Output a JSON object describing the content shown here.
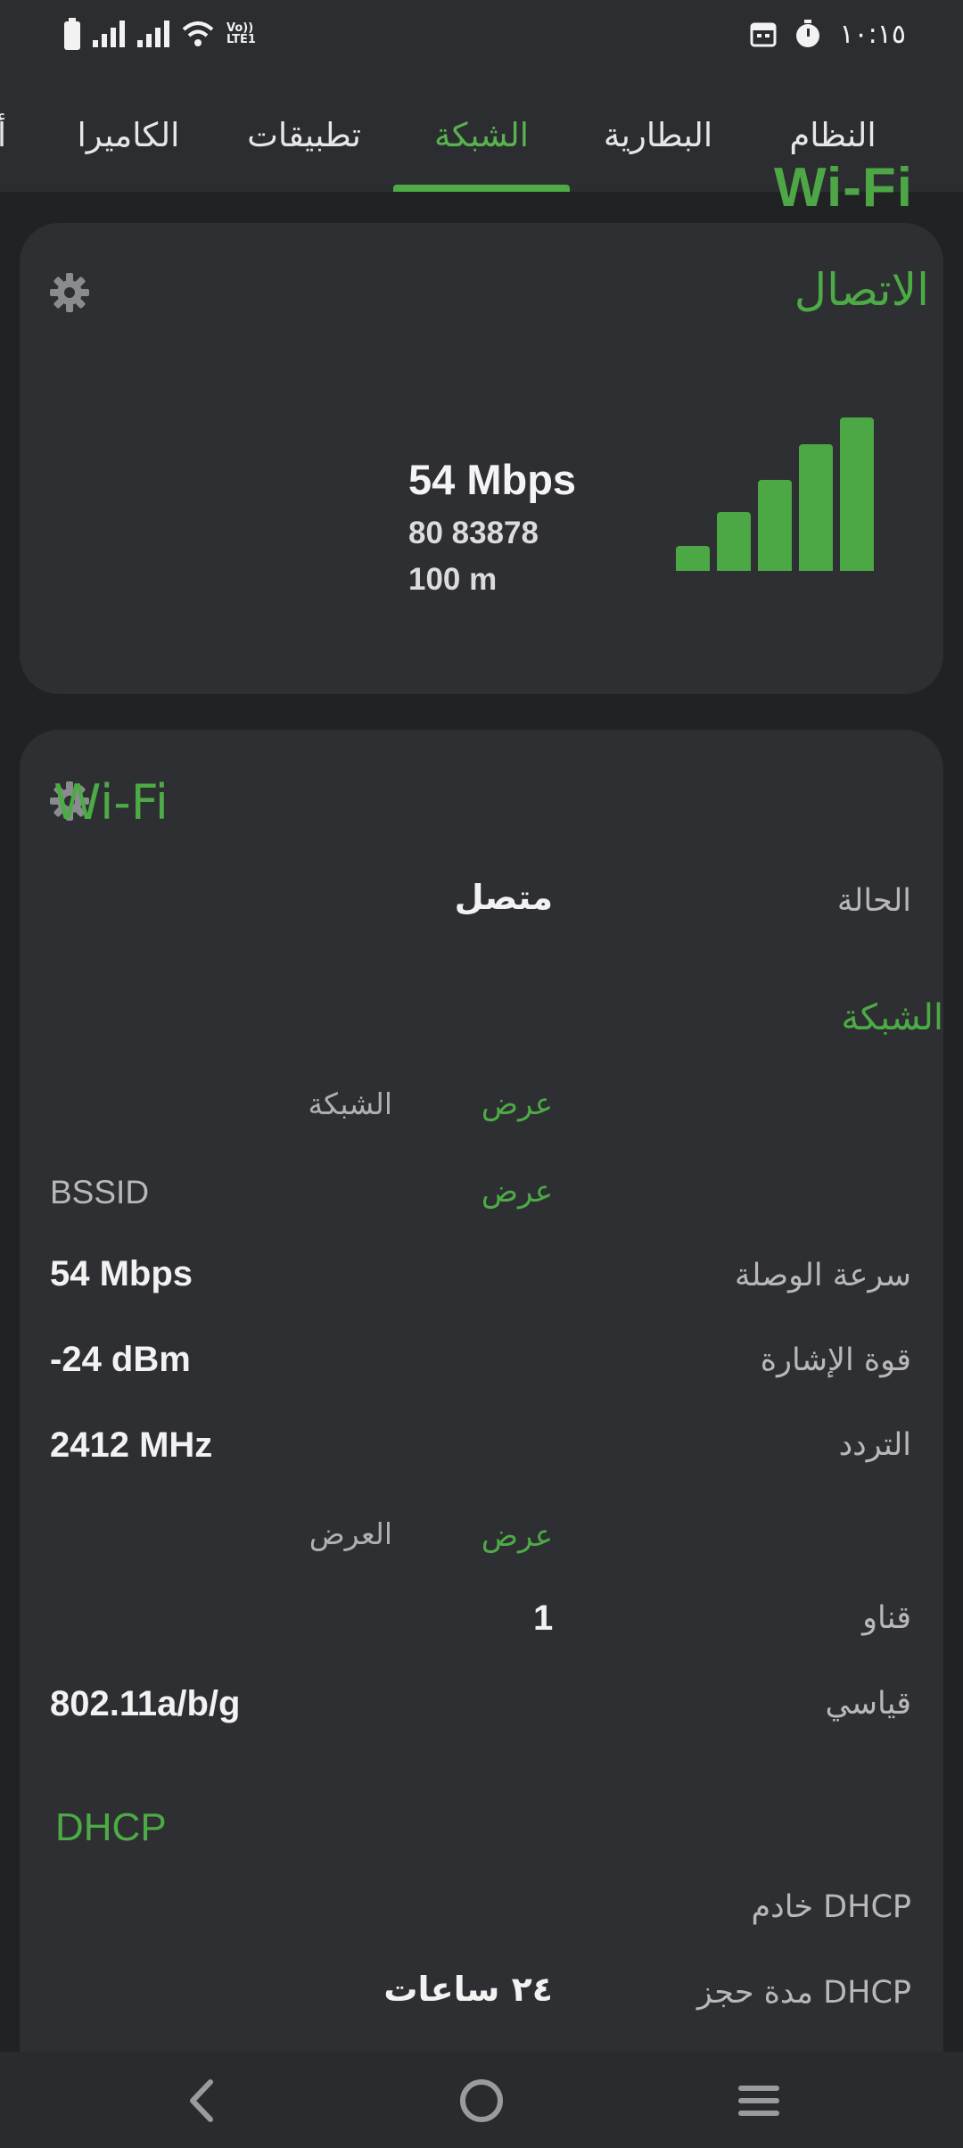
{
  "status_bar": {
    "time": "١٠:١٥",
    "lte_line1": "Vo))",
    "lte_line2": "LTE1",
    "icons": [
      "battery-icon",
      "signal-icon",
      "signal-icon",
      "wifi-icon",
      "calendar-icon",
      "stopwatch-icon"
    ]
  },
  "tabs": [
    {
      "label": "النظام"
    },
    {
      "label": "البطارية"
    },
    {
      "label": "الشبكة",
      "active": true
    },
    {
      "label": "تطبيقات"
    },
    {
      "label": "الكاميرا"
    },
    {
      "label": "أ"
    }
  ],
  "connection_card": {
    "title": "الاتصال",
    "type_label": "Wi-Fi",
    "speed": "54 Mbps",
    "line2": "80 83878",
    "line3": "100 m",
    "signal_bars": [
      0.14,
      0.33,
      0.51,
      0.71,
      0.86
    ]
  },
  "wifi_card": {
    "title": "Wi-Fi",
    "status_label": "الحالة",
    "status_value": "متصل",
    "network_section": "الشبكة",
    "network_row": {
      "link": "عرض",
      "label": "الشبكة"
    },
    "bssid_row": {
      "label": "BSSID",
      "link": "عرض"
    },
    "link_speed": {
      "label": "سرعة الوصلة",
      "value": "54 Mbps"
    },
    "signal_strength": {
      "label": "قوة الإشارة",
      "value": "-24 dBm"
    },
    "frequency": {
      "label": "التردد",
      "value": "2412 MHz"
    },
    "width_row": {
      "link": "عرض",
      "label": "العرض"
    },
    "channel": {
      "label": "قناو",
      "value": "1"
    },
    "standard": {
      "label": "قياسي",
      "value": "802.11a/b/g"
    },
    "dhcp_section": "DHCP",
    "dhcp_server": {
      "label": "خادم DHCP"
    },
    "dhcp_lease": {
      "label": "مدة حجز DHCP",
      "value": "٢٤ ساعات"
    }
  },
  "colors": {
    "accent": "#4cab45",
    "card": "#2e2f33",
    "background": "#212224"
  }
}
